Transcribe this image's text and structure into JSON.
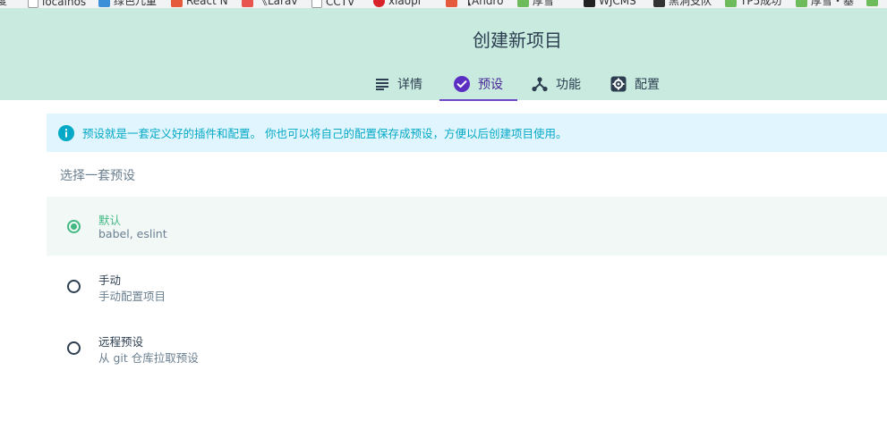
{
  "bookmarks": [
    {
      "label": "度",
      "icon": "bookmark-icon"
    },
    {
      "label": "localhos",
      "icon": "page-icon"
    },
    {
      "label": "绿色儿童",
      "icon": "site-icon"
    },
    {
      "label": "React N",
      "icon": "site-icon"
    },
    {
      "label": "《Larav",
      "icon": "site-icon"
    },
    {
      "label": "CCTV",
      "icon": "page-icon"
    },
    {
      "label": "xiaopi",
      "icon": "site-icon"
    },
    {
      "label": "【Andro",
      "icon": "site-icon"
    },
    {
      "label": "厚雪",
      "icon": "site-icon"
    },
    {
      "label": "WJCMS",
      "icon": "site-icon"
    },
    {
      "label": "黑洞支队",
      "icon": "site-icon"
    },
    {
      "label": "TP5成功",
      "icon": "site-icon"
    },
    {
      "label": "厚雪・基",
      "icon": "site-icon"
    }
  ],
  "header": {
    "title": "创建新项目",
    "tabs": [
      {
        "label": "详情",
        "icon": "list-icon"
      },
      {
        "label": "预设",
        "icon": "check-circle-icon"
      },
      {
        "label": "功能",
        "icon": "fork-icon"
      },
      {
        "label": "配置",
        "icon": "settings-icon"
      }
    ],
    "active_tab": "预设"
  },
  "info": {
    "text": "预设就是一套定义好的插件和配置。 你也可以将自己的配置保存成预设，方便以后创建项目使用。",
    "icon": "info-icon"
  },
  "section_title": "选择一套预设",
  "presets": [
    {
      "name": "默认",
      "description": "babel, eslint",
      "selected": true
    },
    {
      "name": "手动",
      "description": "手动配置项目",
      "selected": false
    },
    {
      "name": "远程预设",
      "description": "从 git 仓库拉取预设",
      "selected": false
    }
  ],
  "colors": {
    "header_bg": "#c8eadf",
    "accent": "#42b983",
    "tab_active": "#6e47c9",
    "info_bg": "#e1f5fe",
    "info_text": "#03a9c6"
  }
}
